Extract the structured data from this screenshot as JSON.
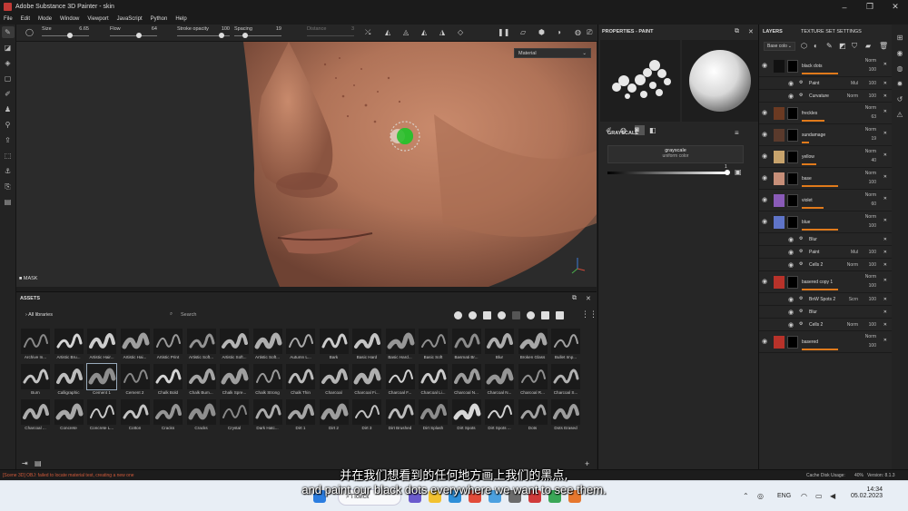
{
  "window": {
    "title": "Adobe Substance 3D Painter - skin"
  },
  "menu": [
    "File",
    "Edit",
    "Mode",
    "Window",
    "Viewport",
    "JavaScript",
    "Python",
    "Help"
  ],
  "brush_params": [
    {
      "label": "Size",
      "value": "6.65"
    },
    {
      "label": "Flow",
      "value": "64"
    },
    {
      "label": "Stroke opacity",
      "value": "100"
    },
    {
      "label": "Spacing",
      "value": "19"
    },
    {
      "label": "Distance",
      "value": "3"
    }
  ],
  "viewport": {
    "material_select": "Material",
    "mask_label": "MASK"
  },
  "assets": {
    "title": "ASSETS",
    "library": "All libraries",
    "search_placeholder": "Search",
    "items": [
      "Archive In...",
      "Artistic Bru...",
      "Artistic Hair...",
      "Artistic Hai...",
      "Artistic Print",
      "Artistic Soft...",
      "Artistic Soft...",
      "Artistic Soft...",
      "Autumn L...",
      "Bark",
      "Basic Hard",
      "Basic Hard...",
      "Basic Soft",
      "Basmati Br...",
      "Blur",
      "Broken Glass",
      "Bullet Imp...",
      "Burn",
      "Calligraphic",
      "Cement 1",
      "Cement 2",
      "Chalk Bold",
      "Chalk Bum...",
      "Chalk Spre...",
      "Chalk Strong",
      "Chalk Thin",
      "Charcoal",
      "Charcoal Fi...",
      "Charcoal F...",
      "Charcoal Li...",
      "Charcoal N...",
      "Charcoal N...",
      "Charcoal R...",
      "Charcoal S...",
      "Charcoal ...",
      "Concrete",
      "Concrete L...",
      "Cotton",
      "Cracks",
      "Cracks",
      "Crystal",
      "Dark Hatc...",
      "Dirt 1",
      "Dirt 2",
      "Dirt 3",
      "Dirt Brushed",
      "Dirt Splash",
      "Dirt Spots",
      "Dirt Spots ...",
      "Dots",
      "Dots Erased"
    ],
    "selected": "Cement 1"
  },
  "properties": {
    "title": "PROPERTIES - PAINT",
    "section": "GRAYSCALE",
    "value_name": "grayscale",
    "value_sub": "uniform color",
    "slider_value": "1"
  },
  "layers": {
    "tab1": "LAYERS",
    "tab2": "TEXTURE SET SETTINGS",
    "channel": "Base colo",
    "rows": [
      {
        "name": "black dots",
        "blend": "Norm",
        "opacity": "100",
        "swatch": "#111111",
        "kind": "layer"
      },
      {
        "name": "Paint",
        "blend": "Mul",
        "opacity": "100",
        "kind": "effect"
      },
      {
        "name": "Curvature",
        "blend": "Norm",
        "opacity": "100",
        "kind": "effect"
      },
      {
        "name": "freckles",
        "blend": "Norm",
        "opacity": "63",
        "swatch": "#6b3a22",
        "kind": "layer"
      },
      {
        "name": "sundamage",
        "blend": "Norm",
        "opacity": "19",
        "swatch": "#5a3a2c",
        "kind": "layer"
      },
      {
        "name": "yellow",
        "blend": "Norm",
        "opacity": "40",
        "swatch": "#c7a36c",
        "kind": "layer"
      },
      {
        "name": "base",
        "blend": "Norm",
        "opacity": "100",
        "swatch": "#c78f79",
        "kind": "layer"
      },
      {
        "name": "violet",
        "blend": "Norm",
        "opacity": "60",
        "swatch": "#8a5bb8",
        "kind": "layer"
      },
      {
        "name": "blue",
        "blend": "Norm",
        "opacity": "100",
        "swatch": "#5f74c8",
        "kind": "layer"
      },
      {
        "name": "Blur",
        "blend": "",
        "opacity": "",
        "kind": "effect"
      },
      {
        "name": "Paint",
        "blend": "Mul",
        "opacity": "100",
        "kind": "effect"
      },
      {
        "name": "Cells 2",
        "blend": "Norm",
        "opacity": "100",
        "kind": "effect"
      },
      {
        "name": "basered copy 1",
        "blend": "Norm",
        "opacity": "100",
        "swatch": "#b8322a",
        "kind": "layer"
      },
      {
        "name": "BnW Spots 2",
        "blend": "Scrn",
        "opacity": "100",
        "kind": "effect"
      },
      {
        "name": "Blur",
        "blend": "",
        "opacity": "",
        "kind": "effect"
      },
      {
        "name": "Cells 2",
        "blend": "Norm",
        "opacity": "100",
        "kind": "effect"
      },
      {
        "name": "basered",
        "blend": "Norm",
        "opacity": "100",
        "swatch": "#b8322a",
        "kind": "layer"
      }
    ]
  },
  "status": {
    "error": "[Scene 3D] OBJ: failed to locate material test, creating a new one",
    "disk": "Cache Disk Usage:",
    "disk_pct": "40%",
    "version": "Version: 8.1.3"
  },
  "taskbar": {
    "search": "Поиск",
    "lang": "ENG",
    "time": "14:34",
    "date": "05.02.2023"
  },
  "subtitles": {
    "cn": "并在我们想看到的任何地方画上我们的黑点,",
    "en": "and paint our black dots everywhere we want to see them."
  }
}
